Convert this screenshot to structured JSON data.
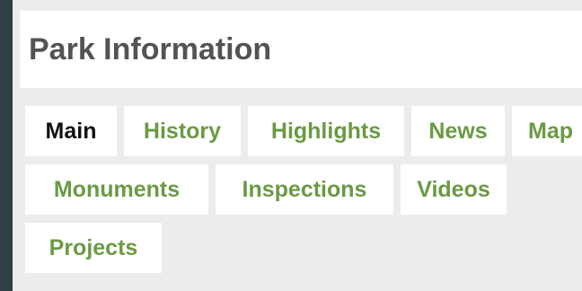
{
  "page": {
    "title": "Park Information"
  },
  "tabs": [
    {
      "label": "Main",
      "active": true
    },
    {
      "label": "History",
      "active": false
    },
    {
      "label": "Highlights",
      "active": false
    },
    {
      "label": "News",
      "active": false
    },
    {
      "label": "Map",
      "active": false
    },
    {
      "label": "Monuments",
      "active": false
    },
    {
      "label": "Inspections",
      "active": false
    },
    {
      "label": "Videos",
      "active": false
    },
    {
      "label": "Projects",
      "active": false
    }
  ],
  "colors": {
    "tab_link": "#6b9a44",
    "tab_active": "#111111",
    "title": "#535353",
    "panel_background": "#ececec",
    "page_background": "#2f4048"
  }
}
